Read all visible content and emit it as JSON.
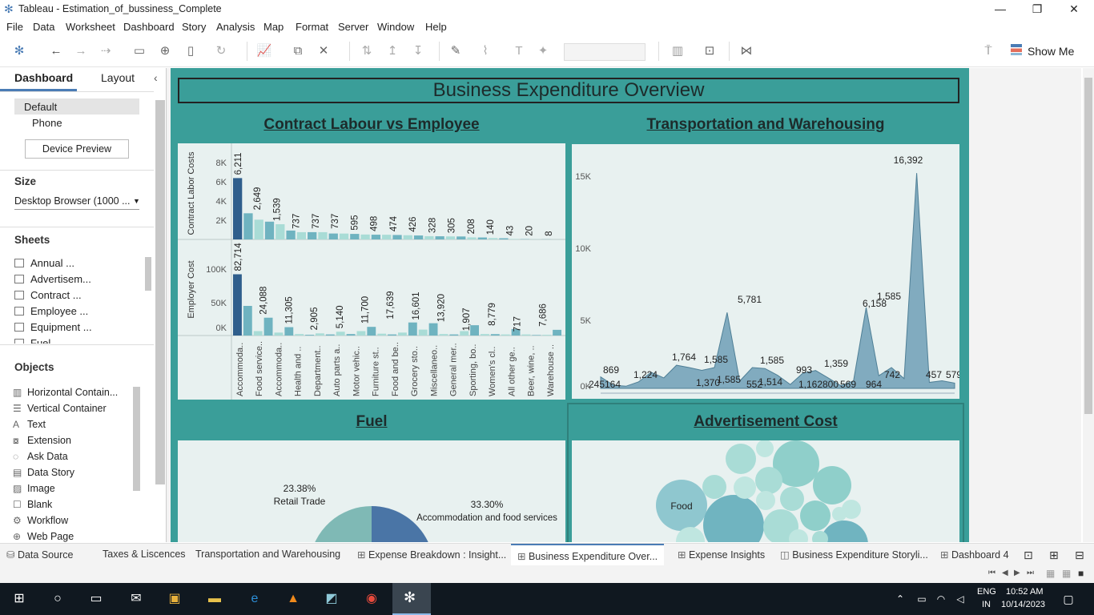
{
  "window": {
    "title": "Tableau - Estimation_of_bussiness_Complete",
    "minimize": "—",
    "restore": "❐",
    "close": "✕"
  },
  "menu": [
    "File",
    "Data",
    "Worksheet",
    "Dashboard",
    "Story",
    "Analysis",
    "Map",
    "Format",
    "Server",
    "Window",
    "Help"
  ],
  "toolbar": {
    "show_me": "Show Me"
  },
  "left_panel": {
    "tabs": {
      "dashboard": "Dashboard",
      "layout": "Layout"
    },
    "devices": {
      "default": "Default",
      "phone": "Phone",
      "preview_button": "Device Preview"
    },
    "size": {
      "heading": "Size",
      "value": "Desktop Browser (1000 ..."
    },
    "sheets": {
      "heading": "Sheets",
      "items": [
        "Annual ...",
        "Advertisem...",
        "Contract ...",
        "Employee ...",
        "Equipment ...",
        "Fuel"
      ]
    },
    "objects": {
      "heading": "Objects",
      "items": [
        {
          "label": "Horizontal Contain...",
          "icon": "horizontal-container-icon"
        },
        {
          "label": "Vertical Container",
          "icon": "vertical-container-icon"
        },
        {
          "label": "Text",
          "icon": "text-icon"
        },
        {
          "label": "Extension",
          "icon": "extension-icon"
        },
        {
          "label": "Ask Data",
          "icon": "ask-data-icon"
        },
        {
          "label": "Data Story",
          "icon": "data-story-icon"
        },
        {
          "label": "Image",
          "icon": "image-icon"
        },
        {
          "label": "Blank",
          "icon": "blank-icon"
        },
        {
          "label": "Workflow",
          "icon": "workflow-icon"
        },
        {
          "label": "Web Page",
          "icon": "web-page-icon"
        }
      ]
    }
  },
  "dashboard": {
    "title": "Business Expenditure Overview",
    "charts": {
      "contract": "Contract Labour vs Employee",
      "transport": "Transportation and Warehousing",
      "fuel": "Fuel",
      "ads": "Advertisement Cost"
    }
  },
  "chart_data": [
    {
      "type": "bar",
      "title": "Contract Labour vs Employee",
      "categories": [
        "Accommoda..",
        "Food service..",
        "Accommoda..",
        "Health and ..",
        "Department..",
        "Auto parts a..",
        "Motor vehic..",
        "Furniture st..",
        "Food and be..",
        "Grocery sto..",
        "Miscellaneo..",
        "General mer..",
        "Sporting, bo..",
        "Women's cl..",
        "All other ge..",
        "Beer, wine, ..",
        "Warehouse .."
      ],
      "series": [
        {
          "name": "Contract Labor Costs",
          "ylabel": "Contract Labor Costs",
          "ticks": [
            "8K",
            "6K",
            "4K",
            "2K"
          ],
          "ylim": [
            0,
            9000
          ],
          "values": [
            6211,
            2649,
            2000,
            1800,
            1539,
            900,
            737,
            737,
            737,
            600,
            595,
            560,
            498,
            480,
            474,
            450,
            426,
            400,
            328,
            320,
            305,
            300,
            208,
            200,
            140,
            120,
            43,
            30,
            20,
            15,
            8
          ],
          "labels": [
            "6,211",
            "2,649",
            "1,539",
            "737",
            "737",
            "737",
            "595",
            "498",
            "474",
            "426",
            "328",
            "305",
            "208",
            "140",
            "43",
            "20",
            "8"
          ]
        },
        {
          "name": "Employer Cost",
          "ylabel": "Employer Cost",
          "ticks": [
            "100K",
            "50K",
            "0K"
          ],
          "ylim": [
            0,
            120000
          ],
          "values": [
            82714,
            40000,
            6000,
            24088,
            4000,
            11305,
            2000,
            1000,
            2905,
            1500,
            5140,
            2000,
            6000,
            11700,
            2500,
            1500,
            4000,
            17639,
            8000,
            16601,
            2000,
            1500,
            6000,
            13920,
            2000,
            1907,
            1500,
            8779,
            1500,
            717,
            1000,
            7686
          ],
          "labels": [
            "82,714",
            "24,088",
            "11,305",
            "2,905",
            "5,140",
            "11,700",
            "17,639",
            "16,601",
            "13,920",
            "1,907",
            "8,779",
            "717",
            "7,686"
          ]
        }
      ]
    },
    {
      "type": "area",
      "title": "Transportation and Warehousing",
      "yticks": [
        "15K",
        "10K",
        "5K",
        "0K"
      ],
      "ylim": [
        0,
        17500
      ],
      "values": [
        869,
        245,
        164,
        500,
        1224,
        800,
        1764,
        1585,
        1370,
        1585,
        5781,
        552,
        1585,
        1514,
        993,
        300,
        1162,
        1359,
        800,
        200,
        569,
        6158,
        964,
        1585,
        742,
        16392,
        457,
        579,
        400
      ],
      "labels": [
        "869",
        "245164",
        "1,224",
        "1,764",
        "1,585",
        "1,370",
        "1,585",
        "5,781",
        "552",
        "1,585",
        "1,514",
        "993",
        "1,162800",
        "1,359",
        "569",
        "6,158",
        "964",
        "1,585",
        "742",
        "16,392",
        "457",
        "579"
      ]
    },
    {
      "type": "pie",
      "title": "Fuel",
      "slices": [
        {
          "label": "Retail Trade",
          "percent": "23.38%",
          "value": 23.38,
          "color": "#7fb9b5"
        },
        {
          "label": "Accommodation and food services",
          "percent": "33.30%",
          "value": 33.3,
          "color": "#4a75a6"
        }
      ]
    },
    {
      "type": "bubble",
      "title": "Advertisement Cost",
      "labels": [
        "Food"
      ]
    }
  ],
  "tabs": [
    "Data Source",
    "Taxes & Liscences",
    "Transportation and Warehousing",
    "Expense Breakdown : Insight...",
    "Business Expenditure Over...",
    "Expense Insights",
    "Business Expenditure Storyli...",
    "Dashboard 4"
  ],
  "taskbar": {
    "lang1": "ENG",
    "lang2": "IN",
    "time": "10:52 AM",
    "date": "10/14/2023"
  }
}
